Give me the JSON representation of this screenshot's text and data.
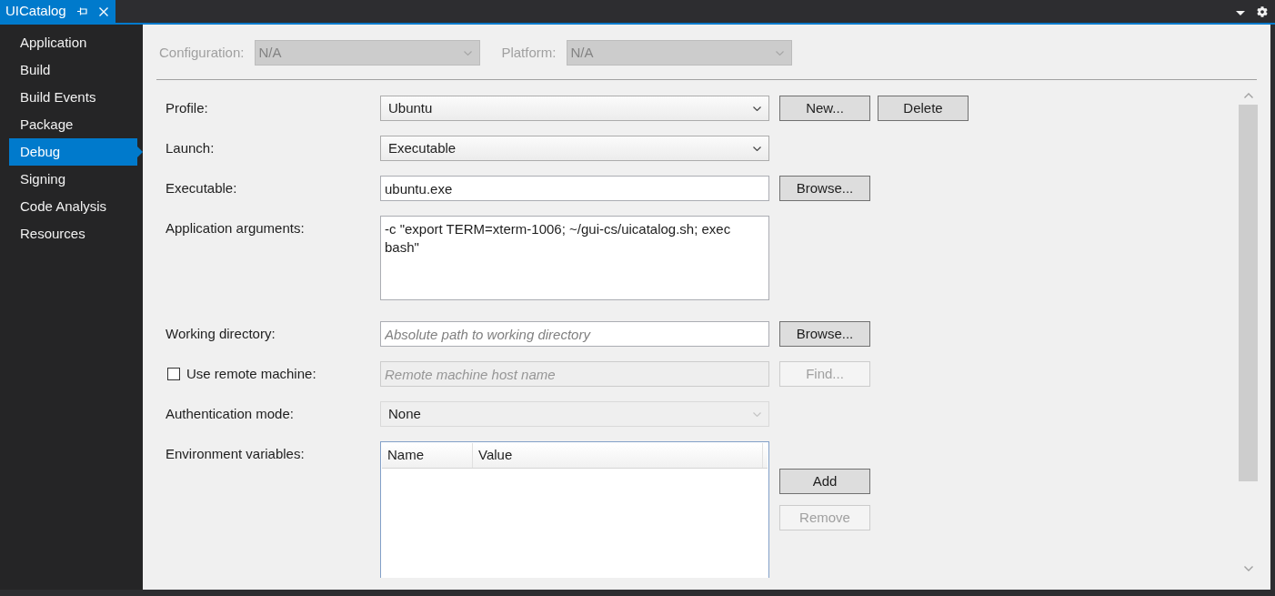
{
  "document_tabs": [
    {
      "title": "UICatalog",
      "selected": true
    }
  ],
  "sidebar": {
    "items": [
      {
        "label": "Application",
        "selected": false
      },
      {
        "label": "Build",
        "selected": false
      },
      {
        "label": "Build Events",
        "selected": false
      },
      {
        "label": "Package",
        "selected": false
      },
      {
        "label": "Debug",
        "selected": true
      },
      {
        "label": "Signing",
        "selected": false
      },
      {
        "label": "Code Analysis",
        "selected": false
      },
      {
        "label": "Resources",
        "selected": false
      }
    ]
  },
  "config_bar": [
    {
      "label": "Configuration:",
      "value": "N/A",
      "disabled": true
    },
    {
      "label": "Platform:",
      "value": "N/A",
      "disabled": true
    }
  ],
  "form": [
    {
      "kind": "dropdown",
      "label": "Profile:",
      "value": "Ubuntu",
      "disabled": false,
      "buttons": [
        {
          "label": "New...",
          "disabled": false
        },
        {
          "label": "Delete",
          "disabled": false
        }
      ]
    },
    {
      "kind": "dropdown",
      "label": "Launch:",
      "value": "Executable",
      "disabled": false
    },
    {
      "kind": "text",
      "label": "Executable:",
      "value": "ubuntu.exe",
      "disabled": false,
      "buttons": [
        {
          "label": "Browse...",
          "disabled": false
        }
      ]
    },
    {
      "kind": "textarea",
      "label": "Application arguments:",
      "value": "-c \"export TERM=xterm-1006; ~/gui-cs/uicatalog.sh; exec bash\"",
      "disabled": false
    },
    {
      "kind": "text",
      "label": "Working directory:",
      "placeholder": "Absolute path to working directory",
      "disabled": false,
      "buttons": [
        {
          "label": "Browse...",
          "disabled": false
        }
      ]
    },
    {
      "kind": "text",
      "label": "Use remote machine:",
      "checked": false,
      "placeholder": "Remote machine host name",
      "disabled": true,
      "buttons": [
        {
          "label": "Find...",
          "disabled": true
        }
      ]
    },
    {
      "kind": "dropdown",
      "label": "Authentication mode:",
      "value": "None",
      "disabled": true
    },
    {
      "kind": "list",
      "label": "Environment variables:",
      "columns": [
        "Name",
        "Value"
      ],
      "disabled": false,
      "buttons": [
        {
          "label": "Add",
          "disabled": false
        },
        {
          "label": "Remove",
          "disabled": true
        }
      ]
    }
  ]
}
